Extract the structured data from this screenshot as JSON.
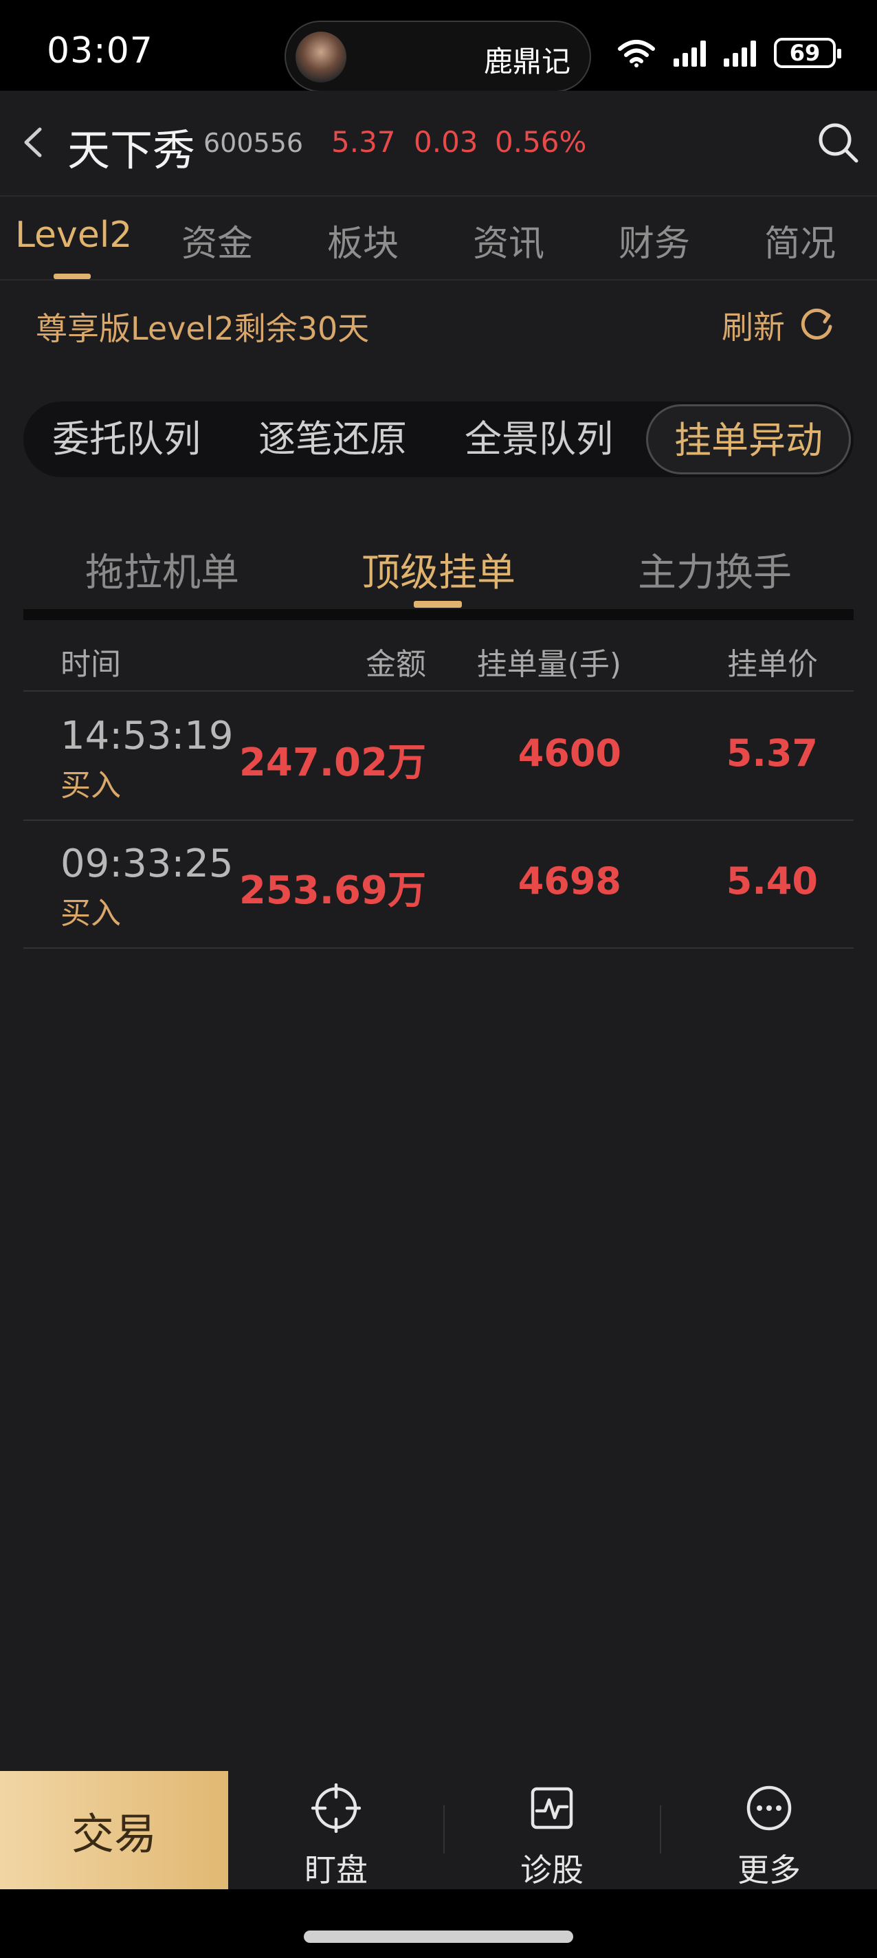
{
  "status_bar": {
    "time": "03:07",
    "island_text": "鹿鼎记",
    "battery": "69"
  },
  "header": {
    "stock_name": "天下秀",
    "stock_code": "600556",
    "price": "5.37",
    "change": "0.03",
    "change_pct": "0.56%"
  },
  "main_tabs": [
    {
      "label": "Level2",
      "active": true
    },
    {
      "label": "资金",
      "active": false
    },
    {
      "label": "板块",
      "active": false
    },
    {
      "label": "资讯",
      "active": false
    },
    {
      "label": "财务",
      "active": false
    },
    {
      "label": "简况",
      "active": false
    }
  ],
  "notice": {
    "text": "尊享版Level2剩余30天",
    "refresh_label": "刷新"
  },
  "segments": [
    {
      "label": "委托队列",
      "active": false
    },
    {
      "label": "逐笔还原",
      "active": false
    },
    {
      "label": "全景队列",
      "active": false
    },
    {
      "label": "挂单异动",
      "active": true
    }
  ],
  "sub_tabs": [
    {
      "label": "拖拉机单",
      "active": false
    },
    {
      "label": "顶级挂单",
      "active": true
    },
    {
      "label": "主力换手",
      "active": false
    }
  ],
  "table": {
    "headers": {
      "time": "时间",
      "amount": "金额",
      "quantity": "挂单量(手)",
      "price": "挂单价"
    },
    "rows": [
      {
        "time": "14:53:19",
        "side": "买入",
        "amount": "247.02万",
        "quantity": "4600",
        "price": "5.37"
      },
      {
        "time": "09:33:25",
        "side": "买入",
        "amount": "253.69万",
        "quantity": "4698",
        "price": "5.40"
      }
    ]
  },
  "bottom_nav": {
    "trade_label": "交易",
    "items": [
      {
        "label": "盯盘",
        "icon": "crosshair-icon"
      },
      {
        "label": "诊股",
        "icon": "pulse-chart-icon"
      },
      {
        "label": "更多",
        "icon": "more-dots-icon"
      }
    ]
  },
  "colors": {
    "accent_gold": "#e0b46e",
    "up_red": "#e84a4a",
    "background": "#1c1c1e"
  }
}
